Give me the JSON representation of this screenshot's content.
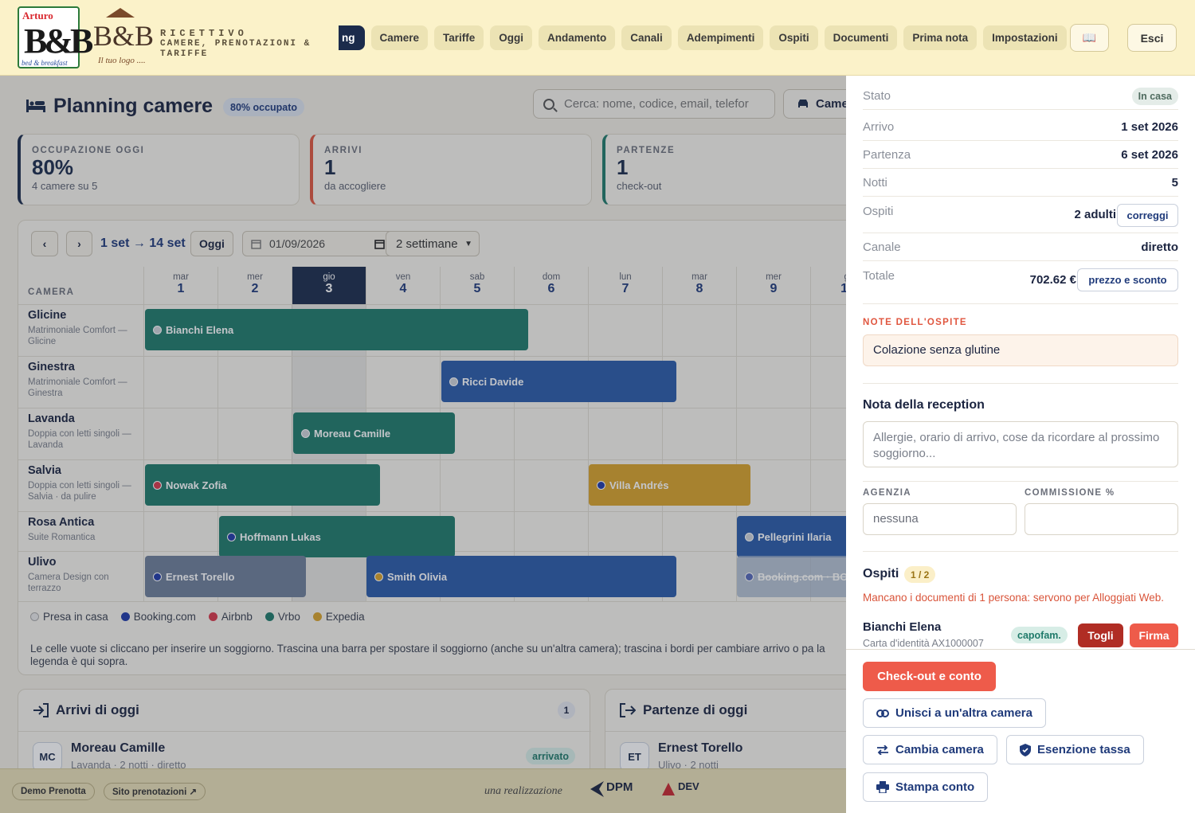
{
  "brand": {
    "logo1_top": "Arturo",
    "logo1_main": "B&B",
    "logo1_sub": "bed & breakfast",
    "logo2_main": "B&B",
    "logo2_sub": "Il tuo logo ....",
    "line1": "RICETTIVO",
    "line2": "CAMERE, PRENOTAZIONI &",
    "line3": "TARIFFE"
  },
  "nav": {
    "active": "ng",
    "items": [
      "Camere",
      "Tariffe",
      "Oggi",
      "Andamento",
      "Canali",
      "Adempimenti",
      "Ospiti",
      "Documenti",
      "Prima nota",
      "Impostazioni"
    ],
    "book_icon": "📖",
    "logout": "Esci"
  },
  "page": {
    "title": "Planning camere",
    "occupancy_badge": "80% occupato",
    "search_placeholder": "Cerca: nome, codice, email, telefor",
    "rooms_btn": "Came"
  },
  "kpis": [
    {
      "label": "OCCUPAZIONE OGGI",
      "value": "80%",
      "sub": "4 camere su 5",
      "color": "#1b2b4b"
    },
    {
      "label": "ARRIVI",
      "value": "1",
      "sub": "da accogliere",
      "color": "#e0563f"
    },
    {
      "label": "PARTENZE",
      "value": "1",
      "sub": "check-out",
      "color": "#1f7a6a"
    }
  ],
  "toolbar": {
    "prev": "‹",
    "next": "›",
    "range": "1 set → 14 set",
    "today": "Oggi",
    "date": "01/09/2026",
    "span": "2 settimane"
  },
  "calendar": {
    "room_header": "CAMERA",
    "days": [
      {
        "dw": "mar",
        "dn": "1"
      },
      {
        "dw": "mer",
        "dn": "2"
      },
      {
        "dw": "gio",
        "dn": "3"
      },
      {
        "dw": "ven",
        "dn": "4"
      },
      {
        "dw": "sab",
        "dn": "5"
      },
      {
        "dw": "dom",
        "dn": "6"
      },
      {
        "dw": "lun",
        "dn": "7"
      },
      {
        "dw": "mar",
        "dn": "8"
      },
      {
        "dw": "mer",
        "dn": "9"
      },
      {
        "dw": "gi",
        "dn": "10"
      }
    ],
    "rooms": [
      {
        "name": "Glicine",
        "desc": "Matrimoniale Comfort — Glicine"
      },
      {
        "name": "Ginestra",
        "desc": "Matrimoniale Comfort — Ginestra"
      },
      {
        "name": "Lavanda",
        "desc": "Doppia con letti singoli — Lavanda"
      },
      {
        "name": "Salvia",
        "desc": "Doppia con letti singoli — Salvia · da pulire"
      },
      {
        "name": "Rosa Antica",
        "desc": "Suite Romantica"
      },
      {
        "name": "Ulivo",
        "desc": "Camera Design con terrazzo"
      }
    ],
    "bookings": [
      {
        "guest": "Bianchi Elena",
        "room": 0,
        "color": "#1f7a6a",
        "dot": "#cfd3d8"
      },
      {
        "guest": "Ricci Davide",
        "room": 1,
        "color": "#2a5aa8",
        "dot": "#cfd3d8"
      },
      {
        "guest": "Moreau Camille",
        "room": 2,
        "color": "#1f7a6a",
        "dot": "#cfd3d8"
      },
      {
        "guest": "Nowak Zofia",
        "room": 3,
        "color": "#1f7a6a",
        "dot": "#d9384a"
      },
      {
        "guest": "Villa Andrés",
        "room": 3,
        "color": "#d8a22a",
        "dot": "#1f3aa8"
      },
      {
        "guest": "Hoffmann Lukas",
        "room": 4,
        "color": "#1f7a6a",
        "dot": "#1f3aa8"
      },
      {
        "guest": "Pellegrini Ilaria",
        "room": 4,
        "color": "#2a5aa8",
        "dot": "#cfd3d8"
      },
      {
        "guest": "Ernest Torello",
        "room": 5,
        "color": "#6e7f99",
        "dot": "#1f3aa8"
      },
      {
        "guest": "Smith Olivia",
        "room": 5,
        "color": "#2a5aa8",
        "dot": "#d8a22a"
      },
      {
        "guest": "Booking.com · BO",
        "room": 5,
        "color": "#9fb0c9",
        "dot": "#1f3aa8"
      }
    ]
  },
  "legend": [
    {
      "label": "Presa in casa",
      "color": "#e8e8e8"
    },
    {
      "label": "Booking.com",
      "color": "#1f3aa8"
    },
    {
      "label": "Airbnb",
      "color": "#d9384a"
    },
    {
      "label": "Vrbo",
      "color": "#1f7a6a"
    },
    {
      "label": "Expedia",
      "color": "#d8a22a"
    }
  ],
  "help": "Le celle vuote si cliccano per inserire un soggiorno. Trascina una barra per spostare il soggiorno (anche su un'altra camera); trascina i bordi per cambiare arrivo o pa la legenda è qui sopra.",
  "arrivals": {
    "title": "Arrivi di oggi",
    "count": "1",
    "initials": "MC",
    "name": "Moreau Camille",
    "detail": "Lavanda · 2 notti · diretto",
    "status": "arrivato"
  },
  "departures": {
    "title": "Partenze di oggi",
    "initials": "ET",
    "name": "Ernest Torello",
    "detail": "Ulivo · 2 notti"
  },
  "footer": {
    "demo": "Demo Prenotta",
    "site": "Sito prenotazioni ↗",
    "credit": "una realizzazione",
    "dpm": "DPM",
    "dev": "DEV"
  },
  "detail": {
    "stato_label": "Stato",
    "stato": "In casa",
    "arrivo_label": "Arrivo",
    "arrivo": "1 set 2026",
    "partenza_label": "Partenza",
    "partenza": "6 set 2026",
    "notti_label": "Notti",
    "notti": "5",
    "ospiti_label": "Ospiti",
    "ospiti": "2 adulti",
    "correggi": "correggi",
    "canale_label": "Canale",
    "canale": "diretto",
    "totale_label": "Totale",
    "totale": "702.62 €",
    "prezzo": "prezzo e sconto",
    "note_label": "NOTE DELL'OSPITE",
    "note": "Colazione senza glutine",
    "reception_label": "Nota della reception",
    "reception_placeholder": "Allergie, orario di arrivo, cose da ricordare al prossimo soggiorno...",
    "agenzia_label": "AGENZIA",
    "agenzia_placeholder": "nessuna",
    "commissione_label": "COMMISSIONE %",
    "guests_title": "Ospiti",
    "guests_count": "1 / 2",
    "warning": "Mancano i documenti di 1 persona: servono per Alloggiati Web.",
    "guest_name": "Bianchi Elena",
    "guest_doc": "Carta d'identità AX1000007",
    "capofam": "capofam.",
    "togli": "Togli",
    "firma": "Firma",
    "checkout": "Check-out e conto",
    "unisci": "Unisci a un'altra camera",
    "cambia": "Cambia camera",
    "esenzione": "Esenzione tassa",
    "stampa": "Stampa conto"
  }
}
